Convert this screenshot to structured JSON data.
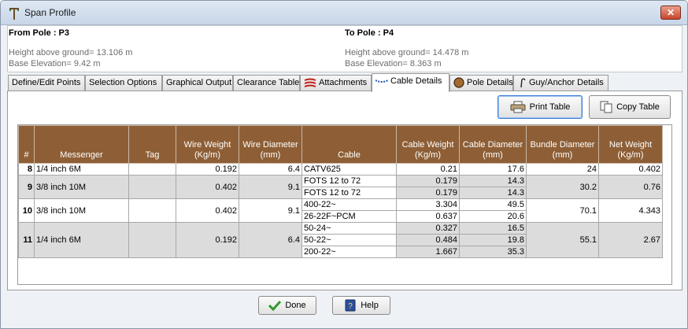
{
  "window": {
    "title": "Span Profile",
    "close_label": "✕"
  },
  "from_pole": {
    "title": "From Pole : P3",
    "height": "Height above ground= 13.106 m",
    "elevation": "Base Elevation= 9.42 m"
  },
  "to_pole": {
    "title": "To Pole : P4",
    "height": "Height above ground= 14.478 m",
    "elevation": "Base Elevation= 8.363 m"
  },
  "tabs": [
    {
      "label": "Define/Edit Points"
    },
    {
      "label": "Selection Options"
    },
    {
      "label": "Graphical Output"
    },
    {
      "label": "Clearance Table"
    },
    {
      "label": "Attachments",
      "icon": "attachments-icon"
    },
    {
      "label": "Cable Details",
      "icon": "cable-icon",
      "active": true
    },
    {
      "label": "Pole Details",
      "icon": "pole-icon"
    },
    {
      "label": "Guy/Anchor Details",
      "icon": "guy-anchor-icon"
    }
  ],
  "buttons": {
    "print": "Print Table",
    "copy": "Copy Table",
    "done": "Done",
    "help": "Help"
  },
  "table": {
    "headers": {
      "num": "#",
      "messenger": "Messenger",
      "tag": "Tag",
      "wire_weight": "Wire Weight (Kg/m)",
      "wire_diameter": "Wire Diameter (mm)",
      "cable": "Cable",
      "cable_weight": "Cable Weight (Kg/m)",
      "cable_diameter": "Cable Diameter (mm)",
      "bundle_diameter": "Bundle Diameter (mm)",
      "net_weight": "Net Weight (Kg/m)"
    },
    "groups": [
      {
        "num": "8",
        "messenger": "1/4 inch 6M",
        "tag": "",
        "wire_weight": "0.192",
        "wire_diameter": "6.4",
        "bundle_diameter": "24",
        "net_weight": "0.402",
        "cables": [
          {
            "cable": "CATV625",
            "weight": "0.21",
            "diameter": "17.6"
          }
        ]
      },
      {
        "num": "9",
        "messenger": "3/8 inch 10M",
        "tag": "",
        "wire_weight": "0.402",
        "wire_diameter": "9.1",
        "bundle_diameter": "30.2",
        "net_weight": "0.76",
        "cables": [
          {
            "cable": "FOTS 12 to 72",
            "weight": "0.179",
            "diameter": "14.3"
          },
          {
            "cable": "FOTS 12 to 72",
            "weight": "0.179",
            "diameter": "14.3"
          }
        ]
      },
      {
        "num": "10",
        "messenger": "3/8 inch 10M",
        "tag": "",
        "wire_weight": "0.402",
        "wire_diameter": "9.1",
        "bundle_diameter": "70.1",
        "net_weight": "4.343",
        "cables": [
          {
            "cable": "400-22~",
            "weight": "3.304",
            "diameter": "49.5"
          },
          {
            "cable": "26-22F~PCM",
            "weight": "0.637",
            "diameter": "20.6"
          }
        ]
      },
      {
        "num": "11",
        "messenger": "1/4 inch 6M",
        "tag": "",
        "wire_weight": "0.192",
        "wire_diameter": "6.4",
        "bundle_diameter": "55.1",
        "net_weight": "2.67",
        "cables": [
          {
            "cable": "50-24~",
            "weight": "0.327",
            "diameter": "16.5"
          },
          {
            "cable": "50-22~",
            "weight": "0.484",
            "diameter": "19.8"
          },
          {
            "cable": "200-22~",
            "weight": "1.667",
            "diameter": "35.3"
          }
        ]
      }
    ]
  }
}
